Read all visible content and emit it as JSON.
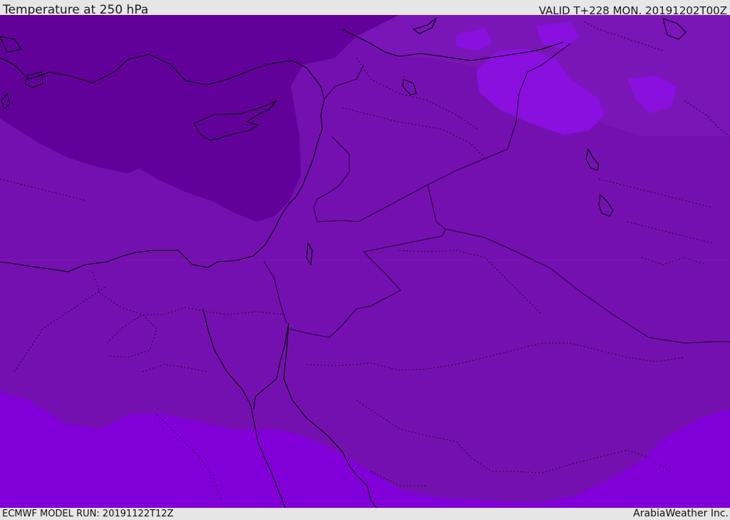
{
  "header": {
    "title": "Temperature at 250 hPa",
    "valid_time": "VALID T+228 MON. 20191202T00Z"
  },
  "footer": {
    "model_run": "ECMWF MODEL RUN: 20191122T12Z",
    "credit": "ArabiaWeather Inc."
  },
  "map": {
    "region": "Eastern Mediterranean and Middle East",
    "colors": {
      "coldest_band": "#62009a",
      "cold_band": "#7510b0",
      "mid_band": "#7a15b8",
      "warm_band": "#8200d8",
      "warm_patch": "#8a10e0",
      "coastline": "#000000",
      "border": "#1a0030"
    },
    "icons": [
      "coastline-lines",
      "country-borders",
      "province-borders"
    ]
  }
}
